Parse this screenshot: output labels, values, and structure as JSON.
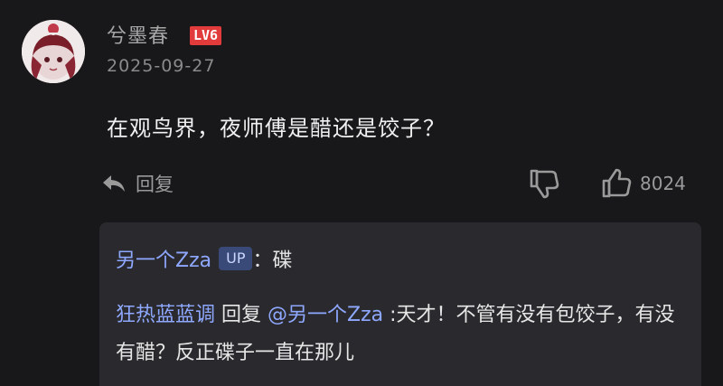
{
  "comment": {
    "username": "兮墨春",
    "level": "LV6",
    "date": "2025-09-27",
    "text": "在观鸟界，夜师傅是醋还是饺子？",
    "reply_label": "回复",
    "like_count": "8024",
    "icons": {
      "reply": "reply-arrow-icon",
      "dislike": "thumbs-down-icon",
      "like": "thumbs-up-icon"
    }
  },
  "replies": [
    {
      "author": "另一个Zza",
      "badge": "UP",
      "sep": "：",
      "text": "碟"
    },
    {
      "author": "狂热蓝蓝调",
      "mid": "回复",
      "mention": "@另一个Zza",
      "text": ":天才！不管有没有包饺子，有没有醋？反正碟子一直在那儿"
    }
  ],
  "colors": {
    "background": "#18181b",
    "reply_box": "#2a2a2e",
    "link": "#8fa8ff",
    "level_badge": "#e23b3b"
  }
}
